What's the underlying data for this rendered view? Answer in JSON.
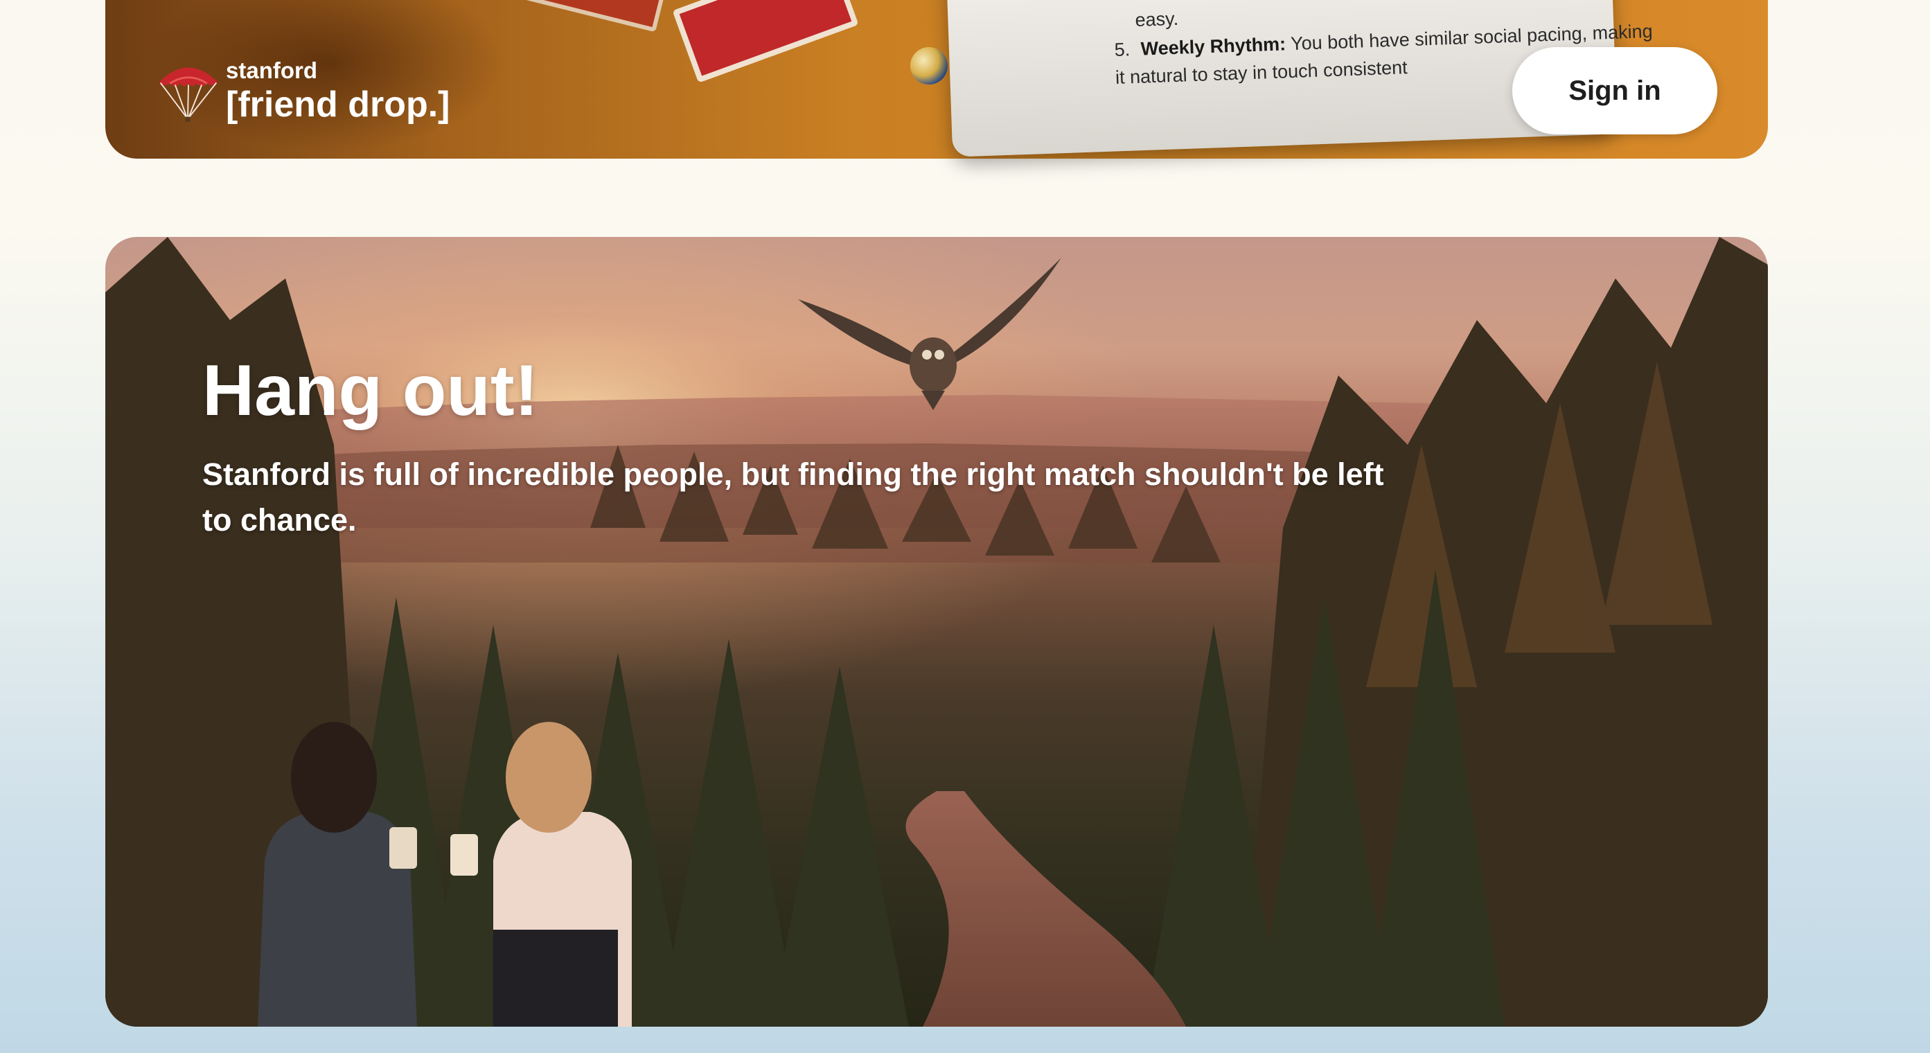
{
  "header": {
    "logo": {
      "icon": "parachute-icon",
      "small_text": "stanford",
      "big_text": "[friend drop.]"
    },
    "info_card": {
      "tail_text": "easy.",
      "item": {
        "number": "5.",
        "title": "Weekly Rhythm:",
        "text": " You both have similar social pacing, making it natural to stay in touch consistent"
      }
    },
    "sign_in_label": "Sign in"
  },
  "hero": {
    "title": "Hang out!",
    "subtitle": "Stanford is full of incredible people, but finding the right match shouldn't be left to chance."
  },
  "colors": {
    "accent_red": "#c0282a",
    "hero_text": "#ffffff",
    "button_bg": "#ffffff"
  }
}
